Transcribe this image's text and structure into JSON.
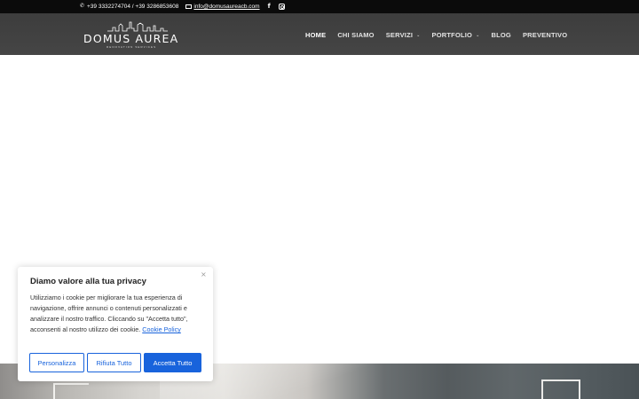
{
  "topbar": {
    "phone_icon": "phone-icon",
    "phones": "+39 3332274704 / +39 3286853608",
    "mail_icon": "envelope-icon",
    "email": "info@domusaureacb.com",
    "social": [
      "facebook-icon",
      "instagram-icon"
    ]
  },
  "header": {
    "logo_text": "DOMUS AUREA",
    "logo_subtitle": "RENOVATION SERVICES",
    "nav": [
      {
        "label": "HOME",
        "active": true,
        "dropdown": false
      },
      {
        "label": "CHI SIAMO",
        "active": false,
        "dropdown": false
      },
      {
        "label": "SERVIZI",
        "active": false,
        "dropdown": true
      },
      {
        "label": "PORTFOLIO",
        "active": false,
        "dropdown": true
      },
      {
        "label": "BLOG",
        "active": false,
        "dropdown": false
      },
      {
        "label": "PREVENTIVO",
        "active": false,
        "dropdown": false
      }
    ]
  },
  "cookie": {
    "title": "Diamo valore alla tua privacy",
    "close_glyph": "×",
    "text": "Utilizziamo i cookie per migliorare la tua esperienza di navigazione, offrire annunci o contenuti personalizzati e analizzare il nostro traffico. Cliccando su \"Accetta tutto\", acconsenti al nostro utilizzo dei cookie.",
    "policy_link": "Cookie Policy",
    "buttons": {
      "customize": "Personalizza",
      "reject": "Rifiuta Tutto",
      "accept": "Accetta Tutto"
    },
    "accent_color": "#1863dc"
  },
  "colors": {
    "topbar_bg": "#0b0b0b",
    "header_bg": "#424242"
  }
}
